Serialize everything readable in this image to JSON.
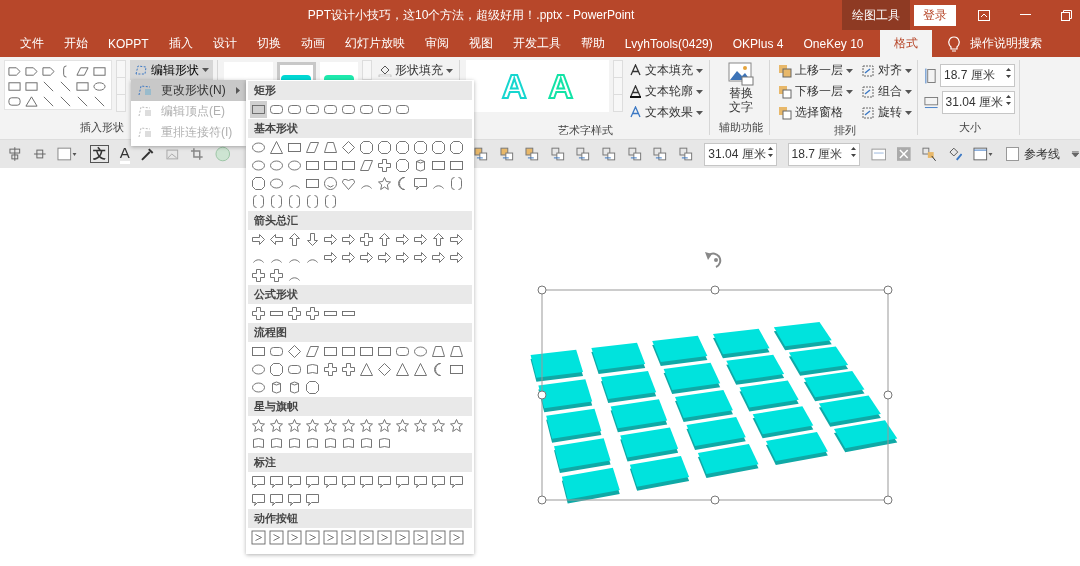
{
  "window": {
    "title": "PPT设计小技巧，这10个方法，超级好用！.pptx  -  PowerPoint",
    "context_group": "绘图工具",
    "login_button": "登录"
  },
  "tabs": [
    {
      "label": "文件",
      "selected": false
    },
    {
      "label": "开始",
      "selected": false
    },
    {
      "label": "KOPPT",
      "selected": false
    },
    {
      "label": "插入",
      "selected": false
    },
    {
      "label": "设计",
      "selected": false
    },
    {
      "label": "切换",
      "selected": false
    },
    {
      "label": "动画",
      "selected": false
    },
    {
      "label": "幻灯片放映",
      "selected": false
    },
    {
      "label": "审阅",
      "selected": false
    },
    {
      "label": "视图",
      "selected": false
    },
    {
      "label": "开发工具",
      "selected": false
    },
    {
      "label": "帮助",
      "selected": false
    },
    {
      "label": "LvyhTools(0429)",
      "selected": false
    },
    {
      "label": "OKPlus 4",
      "selected": false
    },
    {
      "label": "OneKey 10",
      "selected": false
    },
    {
      "label": "格式",
      "selected": true
    }
  ],
  "search": {
    "placeholder": "操作说明搜索"
  },
  "ribbon": {
    "insert_shapes": {
      "label": "插入形状",
      "edit_shape_button": "编辑形状"
    },
    "shape_styles": {
      "fill_button": "形状填充"
    },
    "wordart": {
      "label": "艺术字样式",
      "previews": [
        "A",
        "A"
      ],
      "buttons": [
        "文本填充",
        "文本轮廓",
        "文本效果"
      ]
    },
    "accessibility": {
      "label": "辅助功能",
      "alt_text_button": "替换文字"
    },
    "arrange": {
      "label": "排列",
      "buttons": [
        "上移一层",
        "下移一层",
        "选择窗格"
      ],
      "side_buttons": [
        "对齐",
        "组合",
        "旋转"
      ]
    },
    "size": {
      "label": "大小",
      "height": "18.7 厘米",
      "width": "31.04 厘米"
    }
  },
  "toolbar": {
    "text_direction_glyph": "文",
    "font_color_glyph": "A",
    "width_field": "31.04 厘米",
    "height_field": "18.7 厘米",
    "guides": {
      "label": "参考线",
      "checked": false
    }
  },
  "edit_shape_menu": [
    {
      "label": "更改形状(N)",
      "selected": true,
      "disabled": false
    },
    {
      "label": "编辑顶点(E)",
      "selected": false,
      "disabled": true
    },
    {
      "label": "重排连接符(I)",
      "selected": false,
      "disabled": true
    }
  ],
  "shape_gallery": [
    {
      "title": "矩形"
    },
    {
      "title": "基本形状"
    },
    {
      "title": "箭头总汇"
    },
    {
      "title": "公式形状"
    },
    {
      "title": "流程图"
    },
    {
      "title": "星与旗帜"
    },
    {
      "title": "标注"
    },
    {
      "title": "动作按钮"
    }
  ]
}
